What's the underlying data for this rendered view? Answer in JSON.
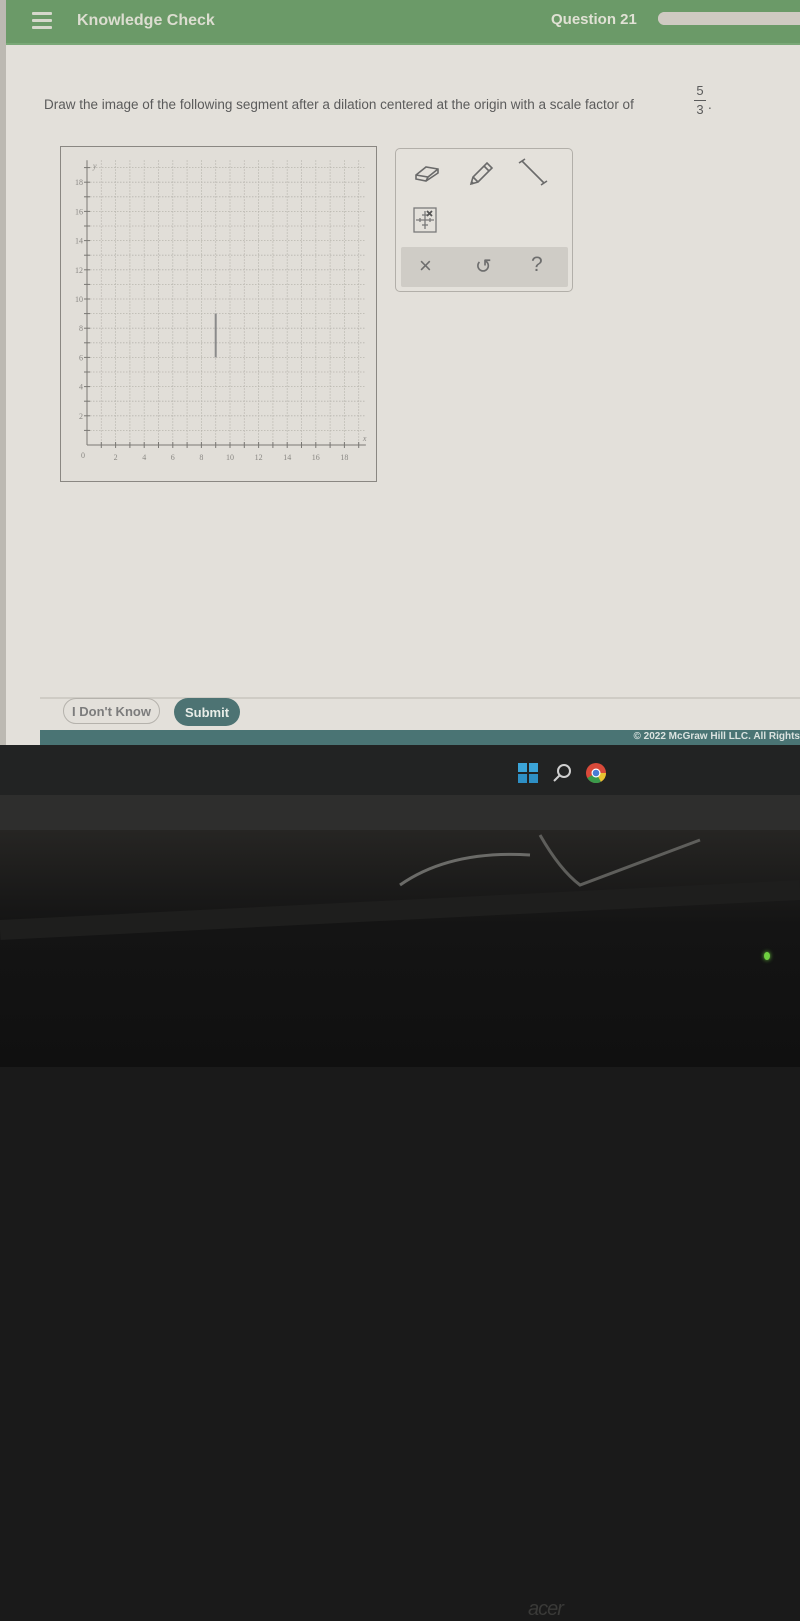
{
  "header": {
    "app_title": "Knowledge Check",
    "question_label": "Question 21",
    "progress_fraction": 1.0,
    "accent_color": "#6b9a68"
  },
  "question": {
    "prompt": "Draw the image of the following segment after a dilation centered at the origin with a scale factor of",
    "scale_numerator": "5",
    "scale_denominator": "3",
    "terminator": "."
  },
  "graph": {
    "x_label": "x",
    "y_label": "y",
    "origin_label": "0",
    "x_ticks": [
      "2",
      "4",
      "6",
      "8",
      "10",
      "12",
      "14",
      "16",
      "18"
    ],
    "y_ticks": [
      "2",
      "4",
      "6",
      "8",
      "10",
      "12",
      "14",
      "16",
      "18"
    ],
    "x_range": [
      0,
      19.5
    ],
    "y_range": [
      0,
      19.5
    ],
    "segments": [
      {
        "x1": 9,
        "y1": 6,
        "x2": 9,
        "y2": 9
      }
    ]
  },
  "tools": {
    "items": [
      {
        "name": "eraser-tool",
        "icon": "eraser-icon"
      },
      {
        "name": "pencil-tool",
        "icon": "pencil-icon"
      },
      {
        "name": "segment-tool",
        "icon": "line-segment-icon"
      },
      {
        "name": "point-tool",
        "icon": "graph-point-icon"
      }
    ],
    "actions": [
      {
        "name": "clear-button",
        "icon": "close-icon",
        "glyph": "×"
      },
      {
        "name": "undo-button",
        "icon": "undo-icon",
        "glyph": "↺"
      },
      {
        "name": "help-button",
        "icon": "help-icon",
        "glyph": "?"
      }
    ]
  },
  "buttons": {
    "dont_know": "I Don't Know",
    "submit": "Submit"
  },
  "footer": {
    "copyright": "© 2022 McGraw Hill LLC. All Rights"
  },
  "taskbar": {
    "icons": [
      "windows-start-icon",
      "search-icon",
      "chrome-icon"
    ]
  },
  "monitor": {
    "brand": "acer"
  }
}
